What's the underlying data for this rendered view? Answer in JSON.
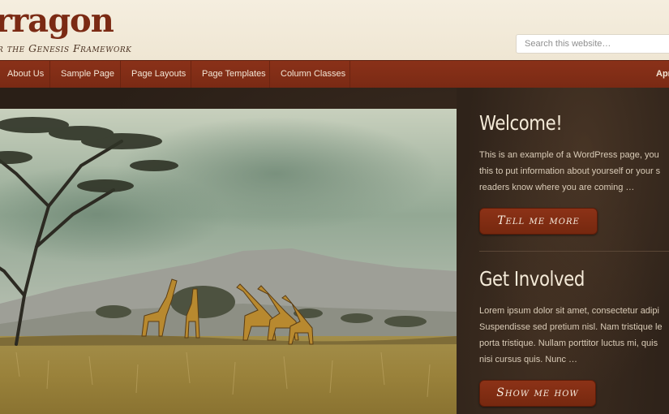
{
  "header": {
    "site_title": "rragon",
    "tagline": "r the Genesis Framework",
    "search_placeholder": "Search this website…"
  },
  "nav": {
    "items": [
      {
        "label": "About Us"
      },
      {
        "label": "Sample Page"
      },
      {
        "label": "Page Layouts"
      },
      {
        "label": "Page Templates"
      },
      {
        "label": "Column Classes"
      }
    ],
    "right_label": "Apr"
  },
  "sidebar": {
    "widgets": [
      {
        "title": "Welcome!",
        "text": "This is an example of a WordPress page, you\nthis to put information about yourself or your s\nreaders know where you are coming …",
        "button": "Tell me more"
      },
      {
        "title": "Get Involved",
        "text": "Lorem ipsum dolor sit amet, consectetur adipi\nSuspendisse sed pretium nisl. Nam tristique le\nporta tristique. Nullam porttitor luctus mi, quis\nnisi cursus quis. Nunc …",
        "button": "Show me how"
      }
    ]
  },
  "colors": {
    "brand": "#7b2a14",
    "nav_bg": "#832e16",
    "header_bg": "#f3ecdd",
    "panel_bg": "#2f231a"
  }
}
